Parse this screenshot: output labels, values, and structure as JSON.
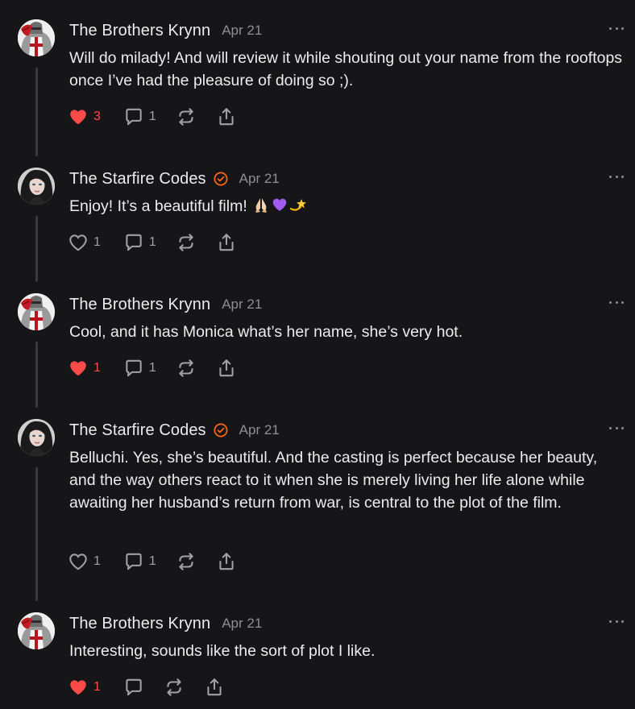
{
  "colors": {
    "background": "#161618",
    "accent_like": "#ff4a4a",
    "verified": "#ff6a13",
    "muted": "#8e8e93",
    "text": "#ececec"
  },
  "comments": [
    {
      "author": "The Brothers Krynn",
      "verified": false,
      "date": "Apr 21",
      "text": "Will do milady! And will review it while shouting out your name from the rooftops once I’ve had the pleasure of doing so ;).",
      "likes": "3",
      "liked": true,
      "replies": "1"
    },
    {
      "author": "The Starfire Codes",
      "verified": true,
      "date": "Apr 21",
      "text": "Enjoy! It’s a beautiful film! ",
      "emojis": [
        "folded-hands-emoji",
        "purple-heart-emoji",
        "dizzy-star-emoji"
      ],
      "likes": "1",
      "liked": false,
      "replies": "1"
    },
    {
      "author": "The Brothers Krynn",
      "verified": false,
      "date": "Apr 21",
      "text": "Cool, and it has Monica what’s her name, she’s very hot.",
      "likes": "1",
      "liked": true,
      "replies": "1"
    },
    {
      "author": "The Starfire Codes",
      "verified": true,
      "date": "Apr 21",
      "text": "Belluchi. Yes, she’s beautiful. And the casting is perfect because her beauty, and the way others react to it when she is merely living her life alone while awaiting her husband’s return from war, is central to the plot of the film.",
      "likes": "1",
      "liked": false,
      "replies": "1"
    },
    {
      "author": "The Brothers Krynn",
      "verified": false,
      "date": "Apr 21",
      "text": "Interesting, sounds like the sort of plot I like.",
      "likes": "1",
      "liked": true,
      "replies": ""
    }
  ],
  "icons": {
    "like": "heart-icon",
    "reply": "comment-bubble-icon",
    "restack": "restack-icon",
    "share": "share-icon",
    "more": "more-options-icon",
    "verified": "verified-badge-icon"
  }
}
